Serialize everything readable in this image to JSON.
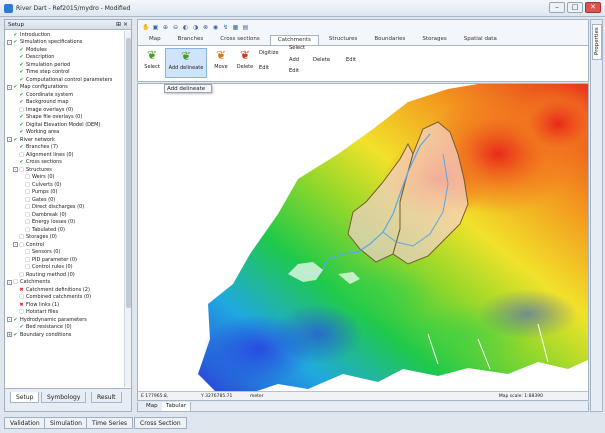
{
  "window": {
    "title": "River Dart - Ref2015/mydro - Modified"
  },
  "setup_panel": {
    "title": "Setup",
    "tree": [
      {
        "label": "Introduction",
        "level": 0,
        "expander": "",
        "check": "ok"
      },
      {
        "label": "Simulation specifications",
        "level": 0,
        "expander": "-",
        "check": "ok"
      },
      {
        "label": "Modules",
        "level": 1,
        "expander": "",
        "check": "ok"
      },
      {
        "label": "Description",
        "level": 1,
        "expander": "",
        "check": "ok"
      },
      {
        "label": "Simulation period",
        "level": 1,
        "expander": "",
        "check": "ok"
      },
      {
        "label": "Time step control",
        "level": 1,
        "expander": "",
        "check": "ok"
      },
      {
        "label": "Computational control parameters",
        "level": 1,
        "expander": "",
        "check": "ok"
      },
      {
        "label": "Map configurations",
        "level": 0,
        "expander": "-",
        "check": "ok"
      },
      {
        "label": "Coordinate system",
        "level": 1,
        "expander": "",
        "check": "ok"
      },
      {
        "label": "Background map",
        "level": 1,
        "expander": "",
        "check": "ok"
      },
      {
        "label": "Image overlays (0)",
        "level": 1,
        "expander": "",
        "check": "no"
      },
      {
        "label": "Shape file overlays (0)",
        "level": 1,
        "expander": "",
        "check": "ok"
      },
      {
        "label": "Digital Elevation Model (DEM)",
        "level": 1,
        "expander": "",
        "check": "ok"
      },
      {
        "label": "Working area",
        "level": 1,
        "expander": "",
        "check": "ok"
      },
      {
        "label": "River network",
        "level": 0,
        "expander": "-",
        "check": "ok"
      },
      {
        "label": "Branches (7)",
        "level": 1,
        "expander": "",
        "check": "ok"
      },
      {
        "label": "Alignment lines (0)",
        "level": 1,
        "expander": "",
        "check": "no"
      },
      {
        "label": "Cross sections",
        "level": 1,
        "expander": "",
        "check": "ok"
      },
      {
        "label": "Structures",
        "level": 1,
        "expander": "-",
        "check": "no"
      },
      {
        "label": "Weirs (0)",
        "level": 2,
        "expander": "",
        "check": "no"
      },
      {
        "label": "Culverts (0)",
        "level": 2,
        "expander": "",
        "check": "no"
      },
      {
        "label": "Pumps (0)",
        "level": 2,
        "expander": "",
        "check": "no"
      },
      {
        "label": "Gates (0)",
        "level": 2,
        "expander": "",
        "check": "no"
      },
      {
        "label": "Direct discharges (0)",
        "level": 2,
        "expander": "",
        "check": "no"
      },
      {
        "label": "Dambreak (0)",
        "level": 2,
        "expander": "",
        "check": "no"
      },
      {
        "label": "Energy losses (0)",
        "level": 2,
        "expander": "",
        "check": "no"
      },
      {
        "label": "Tabulated (0)",
        "level": 2,
        "expander": "",
        "check": "no"
      },
      {
        "label": "Storages (0)",
        "level": 1,
        "expander": "",
        "check": "no"
      },
      {
        "label": "Control",
        "level": 1,
        "expander": "-",
        "check": "no"
      },
      {
        "label": "Sensors (0)",
        "level": 2,
        "expander": "",
        "check": "no"
      },
      {
        "label": "PID parameter (0)",
        "level": 2,
        "expander": "",
        "check": "no"
      },
      {
        "label": "Control rules (0)",
        "level": 2,
        "expander": "",
        "check": "no"
      },
      {
        "label": "Routing method (0)",
        "level": 1,
        "expander": "",
        "check": "no"
      },
      {
        "label": "Catchments",
        "level": 0,
        "expander": "-",
        "check": "no"
      },
      {
        "label": "Catchment definitions (2)",
        "level": 1,
        "expander": "",
        "check": "err"
      },
      {
        "label": "Combined catchments (0)",
        "level": 1,
        "expander": "",
        "check": "no"
      },
      {
        "label": "Flow links (1)",
        "level": 1,
        "expander": "",
        "check": "err"
      },
      {
        "label": "Hotstart files",
        "level": 1,
        "expander": "",
        "check": "no"
      },
      {
        "label": "Hydrodynamic parameters",
        "level": 0,
        "expander": "-",
        "check": "ok"
      },
      {
        "label": "Bed resistance (0)",
        "level": 1,
        "expander": "",
        "check": "ok"
      },
      {
        "label": "Boundary conditions",
        "level": 0,
        "expander": "+",
        "check": "ok"
      }
    ],
    "tabs": [
      "Setup",
      "Symbology",
      "Result"
    ]
  },
  "ribbon": {
    "quick_access_icons": [
      "hand-icon",
      "select-box-icon",
      "zoom-in-icon",
      "zoom-out-icon",
      "zoom-previous-icon",
      "zoom-next-icon",
      "zoom-full-icon",
      "globe-icon",
      "measure-icon",
      "table-icon",
      "legend-icon"
    ],
    "tabs": [
      "Map",
      "Branches",
      "Cross sections",
      "Catchments",
      "Structures",
      "Boundaries",
      "Storages",
      "Spatial data"
    ],
    "active_tab": "Catchments",
    "buttons": {
      "select": "Select",
      "add_delineate": "Add delineate",
      "move": "Move",
      "delete": "Delete",
      "digitize": "Digitize",
      "edit_small": "Edit",
      "select_small": "Select",
      "add_small": "Add",
      "delete_small": "Delete",
      "edit_small2": "Edit",
      "edit_group": "Edit"
    },
    "tooltip": "Add delineate"
  },
  "map": {
    "status_left": "E 177965.8,",
    "status_coords": "Y 3276785.71",
    "status_units": "meter",
    "status_scale": "Map scale: 1:88390",
    "colors": {
      "water": "#ffffff",
      "catchment_fill": "#f4d0cd",
      "catchment_border": "#7a5a2a",
      "river": "#5aa7e8"
    },
    "tabs": [
      "Map",
      "Tabular"
    ]
  },
  "properties_tab": "Properties",
  "bottom_tabs": [
    "Validation",
    "Simulation",
    "Time Series",
    "Cross Section"
  ]
}
